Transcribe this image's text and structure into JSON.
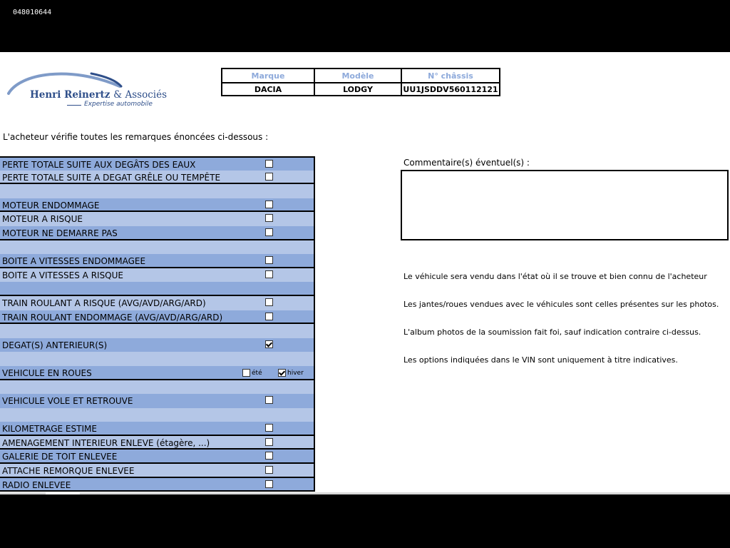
{
  "document": {
    "id": "048010644"
  },
  "logo": {
    "name": "Henri Reinertz",
    "amp_text": "& Associés",
    "subtitle": "Expertise automobile"
  },
  "vehicle": {
    "headers": [
      "Marque",
      "Modèle",
      "N° châssis"
    ],
    "values": [
      "DACIA",
      "LODGY",
      "UU1JSDDV560112121"
    ]
  },
  "intro": "L'acheteur vérifie toutes les remarques énoncées ci-dessous :",
  "checklist": [
    {
      "label": "PERTE TOTALE SUITE AUX DEGÂTS DES EAUX",
      "checked": false
    },
    {
      "label": "PERTE TOTALE SUITE A DEGAT GRÊLE OU TEMPÊTE",
      "checked": false
    },
    {
      "label": "MOTEUR ENDOMMAGE",
      "checked": false
    },
    {
      "label": "MOTEUR A RISQUE",
      "checked": false
    },
    {
      "label": "MOTEUR NE DEMARRE PAS",
      "checked": false
    },
    {
      "label": "BOITE A VITESSES ENDOMMAGEE",
      "checked": false
    },
    {
      "label": "BOITE A VITESSES A RISQUE",
      "checked": false
    },
    {
      "label": "TRAIN ROULANT A RISQUE (AVG/AVD/ARG/ARD)",
      "checked": false
    },
    {
      "label": "TRAIN ROULANT ENDOMMAGE (AVG/AVD/ARG/ARD)",
      "checked": false
    },
    {
      "label": "DEGAT(S) ANTERIEUR(S)",
      "checked": true
    },
    {
      "label": "VEHICULE EN ROUES",
      "ete_label": "été",
      "ete_checked": false,
      "hiver_label": "hiver",
      "hiver_checked": true
    },
    {
      "label": "VEHICULE VOLE ET RETROUVE",
      "checked": false
    },
    {
      "label": "KILOMETRAGE ESTIME",
      "checked": false
    },
    {
      "label": "AMENAGEMENT INTERIEUR ENLEVE (étagère, ...)",
      "checked": false
    },
    {
      "label": "GALERIE DE TOIT ENLEVEE",
      "checked": false
    },
    {
      "label": "ATTACHE REMORQUE ENLEVEE",
      "checked": false
    },
    {
      "label": "RADIO ENLEVEE",
      "checked": false
    }
  ],
  "comments": {
    "label": "Commentaire(s) éventuel(s) :",
    "value": ""
  },
  "notes": [
    "Le véhicule sera vendu dans l'état où il se trouve et bien connu de l'acheteur",
    "Les jantes/roues vendues avec le véhicules sont celles présentes sur les photos.",
    "L'album photos de la soumission fait foi, sauf indication contraire ci-dessus.",
    "Les options indiquées dans le VIN sont uniquement à titre indicatives."
  ],
  "colors": {
    "row_light": "#b4c6e7",
    "row_mid": "#8eaadb",
    "brand_blue": "#2f4f8a",
    "header_blue": "#8eaadb"
  }
}
